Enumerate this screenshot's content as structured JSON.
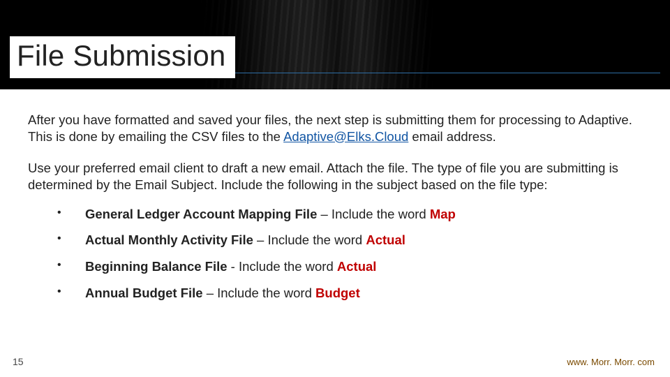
{
  "title": "File Submission",
  "para1_a": "After you have formatted and saved your files, the next step is submitting them for processing to Adaptive.  This is done by emailing the CSV files to the ",
  "email": "Adaptive@Elks.Cloud",
  "para1_b": " email address.",
  "para2": "Use your preferred email client to draft a new email. Attach the file. The type of file you are submitting is determined by the Email Subject. Include the following in the subject based on the file type:",
  "bullets": [
    {
      "file_type": "General Ledger Account Mapping File",
      "sep": " – Include the word ",
      "keyword": "Map"
    },
    {
      "file_type": "Actual Monthly Activity File",
      "sep": " – Include the word ",
      "keyword": "Actual"
    },
    {
      "file_type": "Beginning Balance File",
      "sep": " - Include the word ",
      "keyword": "Actual"
    },
    {
      "file_type": "Annual Budget File",
      "sep": " – Include the word ",
      "keyword": "Budget"
    }
  ],
  "page_number": "15",
  "footer_url": "www. Morr. Morr. com"
}
